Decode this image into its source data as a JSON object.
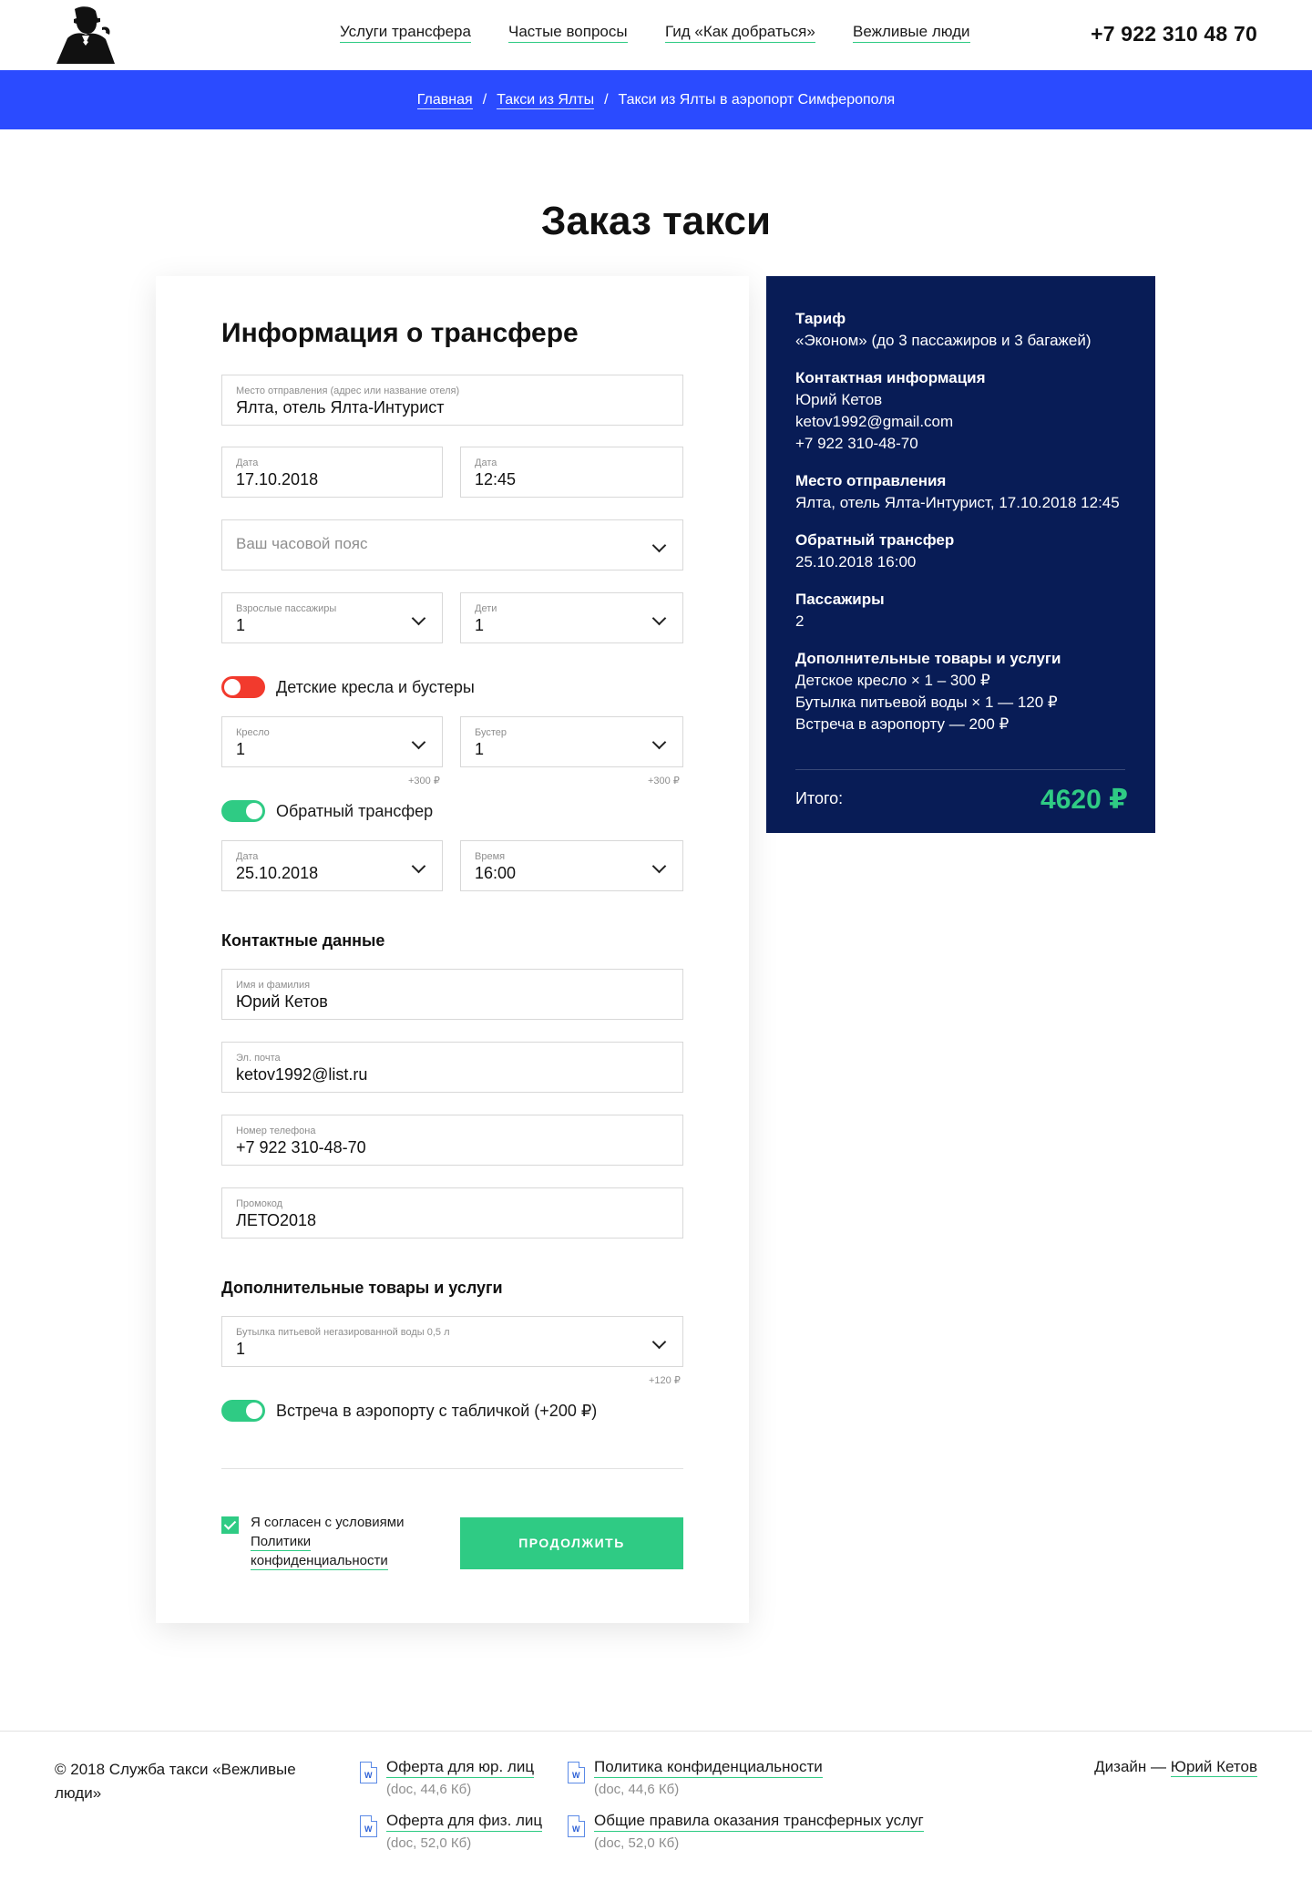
{
  "header": {
    "nav": [
      "Услуги трансфера",
      "Частые вопросы",
      "Гид «Как добраться»",
      "Вежливые люди"
    ],
    "phone": "+7 922 310 48 70"
  },
  "breadcrumbs": [
    "Главная",
    "Такси из Ялты",
    "Такси из Ялты в аэропорт Симферополя"
  ],
  "page_title": "Заказ такси",
  "form": {
    "title": "Информация о трансфере",
    "departure": {
      "label": "Место отправления (адрес или название отеля)",
      "value": "Ялта, отель Ялта-Интурист"
    },
    "date": {
      "label": "Дата",
      "value": "17.10.2018"
    },
    "time": {
      "label": "Дата",
      "value": "12:45"
    },
    "timezone": {
      "placeholder": "Ваш часовой пояс"
    },
    "adults": {
      "label": "Взрослые пассажиры",
      "value": "1"
    },
    "children": {
      "label": "Дети",
      "value": "1"
    },
    "child_seats": {
      "label": "Детские кресла и бустеры",
      "on": false,
      "color": "#f23a2d"
    },
    "seat": {
      "label": "Кресло",
      "value": "1",
      "note": "+300 ₽"
    },
    "booster": {
      "label": "Бустер",
      "value": "1",
      "note": "+300 ₽"
    },
    "return_transfer": {
      "label": "Обратный трансфер",
      "on": true,
      "color": "#2fcb84"
    },
    "return_date": {
      "label": "Дата",
      "value": "25.10.2018"
    },
    "return_time": {
      "label": "Время",
      "value": "16:00"
    },
    "contacts_title": "Контактные данные",
    "name": {
      "label": "Имя и фамилия",
      "value": "Юрий Кетов"
    },
    "email": {
      "label": "Эл. почта",
      "value": "ketov1992@list.ru"
    },
    "phone": {
      "label": "Номер телефона",
      "value": "+7 922 310-48-70"
    },
    "promo": {
      "label": "Промокод",
      "value": "ЛЕТО2018"
    },
    "extras_title": "Дополнительные товары и услуги",
    "water": {
      "label": "Бутылка питьевой негазированной воды 0,5 л",
      "value": "1",
      "note": "+120 ₽"
    },
    "meeting": {
      "label": "Встреча в аэропорту с табличкой (+200 ₽)",
      "on": true
    },
    "agree_text": "Я согласен с условиями",
    "agree_link": "Политики конфиденциальности",
    "agree_checked": true,
    "submit": "ПРОДОЛЖИТЬ"
  },
  "summary": {
    "tariff_title": "Тариф",
    "tariff": "«Эконом» (до 3 пассажиров и 3 багажей)",
    "contact_title": "Контактная информация",
    "contact_name": "Юрий Кетов",
    "contact_email": "ketov1992@gmail.com",
    "contact_phone": "+7 922 310-48-70",
    "departure_title": "Место отправления",
    "departure": "Ялта, отель Ялта-Интурист, 17.10.2018 12:45",
    "return_title": "Обратный трансфер",
    "return": "25.10.2018 16:00",
    "passengers_title": "Пассажиры",
    "passengers": "2",
    "extras_title": "Дополнительные товары и услуги",
    "extras": [
      "Детское кресло × 1 – 300 ₽",
      "Бутылка питьевой воды × 1 — 120 ₽",
      "Встреча в аэропорту — 200 ₽"
    ],
    "total_label": "Итого:",
    "total": "4620 ₽",
    "bg_color": "#081c56"
  },
  "footer": {
    "copyright": "© 2018 Служба такси «Вежливые люди»",
    "docs": [
      {
        "title": "Оферта для юр. лиц",
        "meta": "(doc, 44,6 Кб)"
      },
      {
        "title": "Оферта для физ. лиц",
        "meta": "(doc, 52,0 Кб)"
      },
      {
        "title": "Политика конфиденциальности",
        "meta": "(doc, 44,6 Кб)"
      },
      {
        "title": "Общие правила оказания трансферных услуг",
        "meta": "(doc, 52,0 Кб)"
      }
    ],
    "doc_icon_letter": "W",
    "design_label": "Дизайн —",
    "design_author": "Юрий Кетов"
  },
  "colors": {
    "accent_green": "#2fcb84",
    "breadcrumb_blue": "#2b4bff",
    "toggle_off_red": "#f23a2d"
  }
}
